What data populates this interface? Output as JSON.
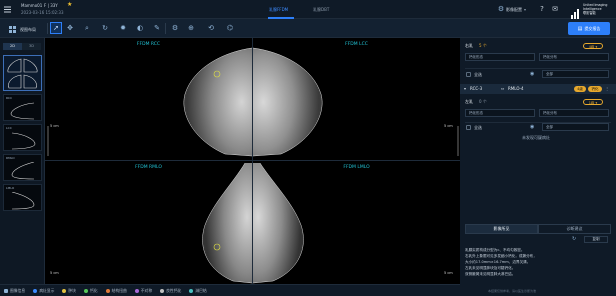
{
  "patient": {
    "name": "Mammo01",
    "sex_age": "F | 33Y",
    "datetime": "2023-03-16 15:02:33"
  },
  "tabs": [
    "乳腺FFDM",
    "乳腺DBT"
  ],
  "header_right": {
    "label": "影像配置",
    "logo_line1": "United Imaging",
    "logo_line2": "Intelligence",
    "logo_line3": "联影智能"
  },
  "toolbar": {
    "layout_label": "视图布局",
    "submit_label": "提交报告"
  },
  "left_panel": {
    "tab_2d": "2D",
    "tab_3d": "3D",
    "thumbs": [
      {
        "label": "",
        "sub": "RCC LCC RMLO LMLO"
      },
      {
        "label": "RCC"
      },
      {
        "label": "LCC"
      },
      {
        "label": "RMLO"
      },
      {
        "label": "LMLO"
      }
    ]
  },
  "viewports": [
    {
      "title": "FFDM RCC",
      "scale": "5 cm"
    },
    {
      "title": "FFDM LCC",
      "scale": "5 cm"
    },
    {
      "title": "FFDM RMLO",
      "scale": "5 cm"
    },
    {
      "title": "FFDM LMLO",
      "scale": "5 cm"
    }
  ],
  "right_panel": {
    "section1_label": "右乳",
    "section1_count": "5 个",
    "section1_badge": "4级",
    "field1a": "钙化形态",
    "field1b": "钙化分布",
    "row1_label": "全选",
    "row1_value": "全部",
    "lesion_title": "RCC-3",
    "lesion_link": "RMLO-4",
    "lesion_badge": "4级",
    "lesion_tag": "钙化",
    "section2_label": "左乳",
    "section2_count": "0 个",
    "section2_badge": "1级",
    "field2a": "钙化形态",
    "field2b": "钙化分布",
    "row2_label": "全选",
    "row2_value": "全部",
    "empty_text": "未发现可疑病灶",
    "bottom_tab1": "影像所见",
    "bottom_tab2": "诊断建议",
    "copy_label": "复制",
    "report_lines": [
      "乳腺实质构成分型为c、不均匀致密。",
      "右乳外上象限可见多发细小钙化，成簇分布，",
      "大小约17.0mm×16.7mm，边界欠清。",
      "左乳未见明显肿块及可疑钙化。",
      "双侧腋窝未见明显肿大淋巴结。"
    ],
    "footer_note": "本结果仅供参考，请以医生诊断为准"
  },
  "status_bar": [
    {
      "label": "图像信息",
      "color": "#8fb3d6"
    },
    {
      "label": "病灶显示",
      "color": "#3d8bff"
    },
    {
      "label": "肿块",
      "color": "#e0c040"
    },
    {
      "label": "钙化",
      "color": "#58c85a"
    },
    {
      "label": "结构扭曲",
      "color": "#e07a3a"
    },
    {
      "label": "不对称",
      "color": "#a86ad8"
    },
    {
      "label": "良性钙化",
      "color": "#c0c0c0"
    },
    {
      "label": "淋巴结",
      "color": "#4ac0c0"
    }
  ],
  "colors": {
    "accent": "#2d7ff9",
    "highlight": "#22c4d6",
    "badge": "#e7a92e"
  }
}
